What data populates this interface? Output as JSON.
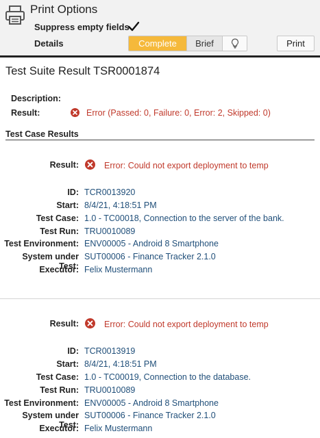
{
  "header": {
    "title": "Print Options",
    "suppress_label": "Suppress empty fields",
    "suppress_checked": true,
    "details_label": "Details",
    "details_options": [
      "Complete",
      "Brief"
    ],
    "details_selected": "Complete",
    "print_label": "Print",
    "accent": "#f5b93b"
  },
  "suite": {
    "title": "Test Suite Result TSR0001874",
    "description_label": "Description:",
    "result_label": "Result:",
    "result_value": "Error (Passed: 0, Failure: 0, Error: 2, Skipped: 0)",
    "section_title": "Test Case Results"
  },
  "labels": {
    "result": "Result:",
    "id": "ID:",
    "start": "Start:",
    "test_case": "Test Case:",
    "test_run": "Test Run:",
    "environment": "Test Environment:",
    "system": "System under Test:",
    "executor": "Executor:"
  },
  "cases": [
    {
      "result": "Error: Could not export deployment to temp",
      "id": "TCR0013920",
      "start": "8/4/21, 4:18:51 PM",
      "test_case": "1.0 - TC00018, Connection to the server of the bank.",
      "test_run": "TRU0010089",
      "environment": "ENV00005 - Android 8 Smartphone",
      "system": "SUT00006 - Finance Tracker 2.1.0",
      "executor": "Felix Mustermann"
    },
    {
      "result": "Error: Could not export deployment to temp",
      "id": "TCR0013919",
      "start": "8/4/21, 4:18:51 PM",
      "test_case": "1.0 - TC00019, Connection to the database.",
      "test_run": "TRU0010089",
      "environment": "ENV00005 - Android 8 Smartphone",
      "system": "SUT00006 - Finance Tracker 2.1.0",
      "executor": "Felix Mustermann"
    }
  ],
  "colors": {
    "error": "#c0392b",
    "link": "#1f4e79"
  }
}
